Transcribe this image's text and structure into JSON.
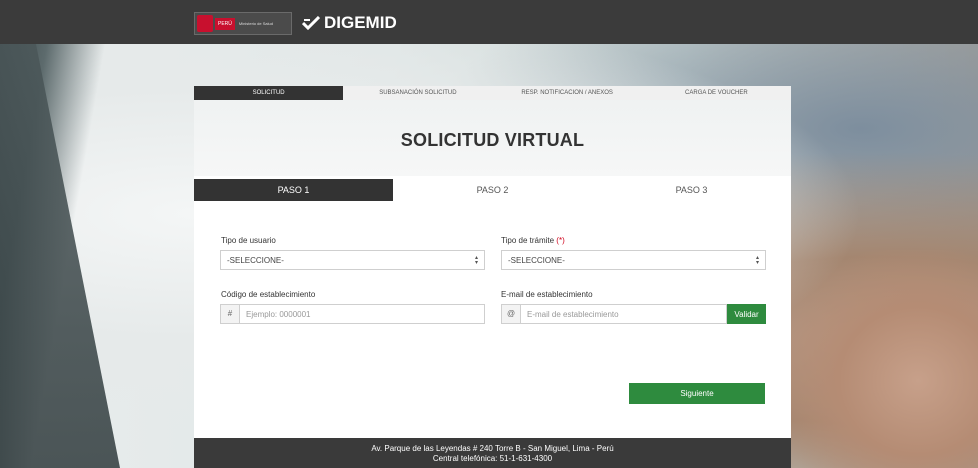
{
  "header": {
    "gob_peru": "PERÚ",
    "gob_ministerio": "Ministerio de Salud",
    "brand": "DIGEMID"
  },
  "tabs": [
    {
      "label": "SOLICITUD",
      "active": true
    },
    {
      "label": "SUBSANACIÓN SOLICITUD",
      "active": false
    },
    {
      "label": "RESP. NOTIFICACION / ANEXOS",
      "active": false
    },
    {
      "label": "CARGA DE VOUCHER",
      "active": false
    }
  ],
  "page_title": "SOLICITUD VIRTUAL",
  "steps": [
    {
      "label": "PASO 1",
      "active": true
    },
    {
      "label": "PASO 2",
      "active": false
    },
    {
      "label": "PASO 3",
      "active": false
    }
  ],
  "form": {
    "tipo_usuario": {
      "label": "Tipo de usuario",
      "value": "-SELECCIONE-"
    },
    "tipo_tramite": {
      "label": "Tipo de trámite",
      "required_mark": "(*)",
      "value": "-SELECCIONE-"
    },
    "codigo": {
      "label": "Código de establecimiento",
      "addon": "#",
      "placeholder": "Ejemplo: 0000001"
    },
    "email": {
      "label": "E-mail de establecimiento",
      "addon": "@",
      "placeholder": "E-mail de establecimiento",
      "button": "Validar"
    },
    "submit": "Siguiente"
  },
  "footer": {
    "address": "Av. Parque de las Leyendas # 240 Torre B - San Miguel, Lima - Perú",
    "phone": "Central telefónica: 51-1-631-4300"
  },
  "colors": {
    "dark": "#333333",
    "green": "#2e8b3e",
    "required": "#d0021b"
  }
}
